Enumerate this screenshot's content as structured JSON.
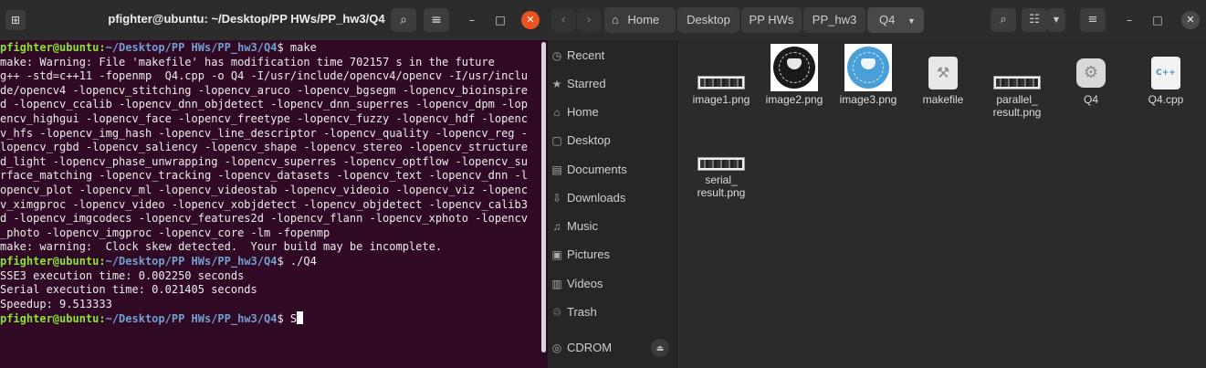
{
  "terminal": {
    "title": "pfighter@ubuntu: ~/Desktop/PP HWs/PP_hw3/Q4",
    "icons": {
      "new_tab": "new-tab-icon",
      "search": "search-icon",
      "menu": "hamburger-menu-icon",
      "minimize": "minimize-icon",
      "maximize": "maximize-icon",
      "close": "close-icon"
    },
    "colors": {
      "background": "#300a24",
      "prompt_user": "#8ae234",
      "prompt_path": "#729fcf",
      "close_button": "#e95420"
    },
    "lines": [
      {
        "user": "pfighter@ubuntu",
        "path": "~/Desktop/PP HWs/PP_hw3/Q4",
        "cmd": "$ make"
      },
      {
        "text": "make: Warning: File 'makefile' has modification time 702157 s in the future"
      },
      {
        "text": "g++ -std=c++11 -fopenmp  Q4.cpp -o Q4 -I/usr/include/opencv4/opencv -I/usr/inclu"
      },
      {
        "text": "de/opencv4 -lopencv_stitching -lopencv_aruco -lopencv_bgsegm -lopencv_bioinspire"
      },
      {
        "text": "d -lopencv_ccalib -lopencv_dnn_objdetect -lopencv_dnn_superres -lopencv_dpm -lop"
      },
      {
        "text": "encv_highgui -lopencv_face -lopencv_freetype -lopencv_fuzzy -lopencv_hdf -lopenc"
      },
      {
        "text": "v_hfs -lopencv_img_hash -lopencv_line_descriptor -lopencv_quality -lopencv_reg -"
      },
      {
        "text": "lopencv_rgbd -lopencv_saliency -lopencv_shape -lopencv_stereo -lopencv_structure"
      },
      {
        "text": "d_light -lopencv_phase_unwrapping -lopencv_superres -lopencv_optflow -lopencv_su"
      },
      {
        "text": "rface_matching -lopencv_tracking -lopencv_datasets -lopencv_text -lopencv_dnn -l"
      },
      {
        "text": "opencv_plot -lopencv_ml -lopencv_videostab -lopencv_videoio -lopencv_viz -lopenc"
      },
      {
        "text": "v_ximgproc -lopencv_video -lopencv_xobjdetect -lopencv_objdetect -lopencv_calib3"
      },
      {
        "text": "d -lopencv_imgcodecs -lopencv_features2d -lopencv_flann -lopencv_xphoto -lopencv"
      },
      {
        "text": "_photo -lopencv_imgproc -lopencv_core -lm -fopenmp"
      },
      {
        "text": "make: warning:  Clock skew detected.  Your build may be incomplete."
      },
      {
        "user": "pfighter@ubuntu",
        "path": "~/Desktop/PP HWs/PP_hw3/Q4",
        "cmd": "$ ./Q4"
      },
      {
        "text": "SSE3 execution time: 0.002250 seconds"
      },
      {
        "text": "Serial execution time: 0.021405 seconds"
      },
      {
        "text": "Speedup: 9.513333"
      },
      {
        "user": "pfighter@ubuntu",
        "path": "~/Desktop/PP HWs/PP_hw3/Q4",
        "cmd": "$ S",
        "cursor": true
      }
    ]
  },
  "file_manager": {
    "nav": {
      "back_icon": "chevron-left-icon",
      "forward_icon": "chevron-right-icon"
    },
    "breadcrumb": {
      "home_icon": "home-icon",
      "items": [
        "Home",
        "Desktop",
        "PP HWs",
        "PP_hw3",
        "Q4"
      ],
      "dropdown_icon": "chevron-down-icon"
    },
    "header_icons": {
      "search": "search-icon",
      "view": "list-view-icon",
      "view_options": "chevron-down-icon",
      "menu": "hamburger-menu-icon",
      "minimize": "minimize-icon",
      "maximize": "maximize-icon",
      "close": "close-icon"
    },
    "sidebar": [
      {
        "label": "Recent",
        "icon": "clock-icon"
      },
      {
        "label": "Starred",
        "icon": "star-icon"
      },
      {
        "label": "Home",
        "icon": "home-icon"
      },
      {
        "label": "Desktop",
        "icon": "desktop-icon"
      },
      {
        "label": "Documents",
        "icon": "documents-icon"
      },
      {
        "label": "Downloads",
        "icon": "download-icon"
      },
      {
        "label": "Music",
        "icon": "music-icon"
      },
      {
        "label": "Pictures",
        "icon": "pictures-icon"
      },
      {
        "label": "Videos",
        "icon": "videos-icon"
      },
      {
        "label": "Trash",
        "icon": "trash-icon"
      },
      {
        "label": "CDROM",
        "icon": "cdrom-icon",
        "eject_icon": "eject-icon"
      }
    ],
    "files": [
      {
        "name": "image1.png",
        "icon": "image-thumbnail-icon"
      },
      {
        "name": "image2.png",
        "icon": "image-thumbnail-icon",
        "seal_color": "#1a1a1a"
      },
      {
        "name": "image3.png",
        "icon": "image-thumbnail-icon",
        "seal_color": "#4a9fd8"
      },
      {
        "name": "makefile",
        "icon": "makefile-icon"
      },
      {
        "name": "parallel_\nresult.png",
        "icon": "image-thumbnail-icon"
      },
      {
        "name": "Q4",
        "icon": "executable-icon"
      },
      {
        "name": "Q4.cpp",
        "icon": "cpp-file-icon"
      },
      {
        "name": "serial_\nresult.png",
        "icon": "image-thumbnail-icon"
      }
    ]
  }
}
